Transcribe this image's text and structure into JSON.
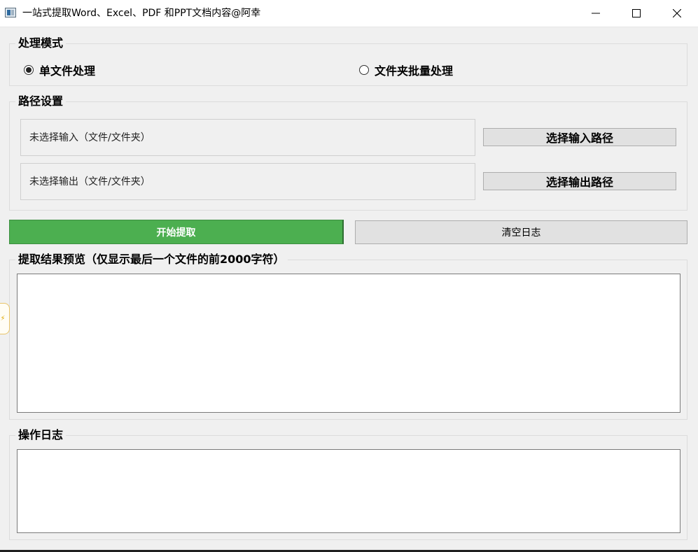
{
  "window": {
    "title": "一站式提取Word、Excel、PDF 和PPT文档内容@阿幸"
  },
  "mode_group": {
    "title": "处理模式",
    "options": [
      {
        "label": "单文件处理",
        "checked": true
      },
      {
        "label": "文件夹批量处理",
        "checked": false
      }
    ]
  },
  "path_group": {
    "title": "路径设置",
    "input_path_text": "未选择输入（文件/文件夹）",
    "output_path_text": "未选择输出（文件/文件夹）",
    "select_input_label": "选择输入路径",
    "select_output_label": "选择输出路径"
  },
  "actions": {
    "start_label": "开始提取",
    "clear_label": "清空日志",
    "start_color": "#4caf50"
  },
  "preview_group": {
    "title": "提取结果预览（仅显示最后一个文件的前2000字符）",
    "content": ""
  },
  "log_group": {
    "title": "操作日志",
    "content": ""
  },
  "icons": {
    "app": "app-window-icon",
    "minimize": "minimize-icon",
    "maximize": "maximize-icon",
    "close": "close-icon",
    "side_handle": "lightning-icon"
  }
}
